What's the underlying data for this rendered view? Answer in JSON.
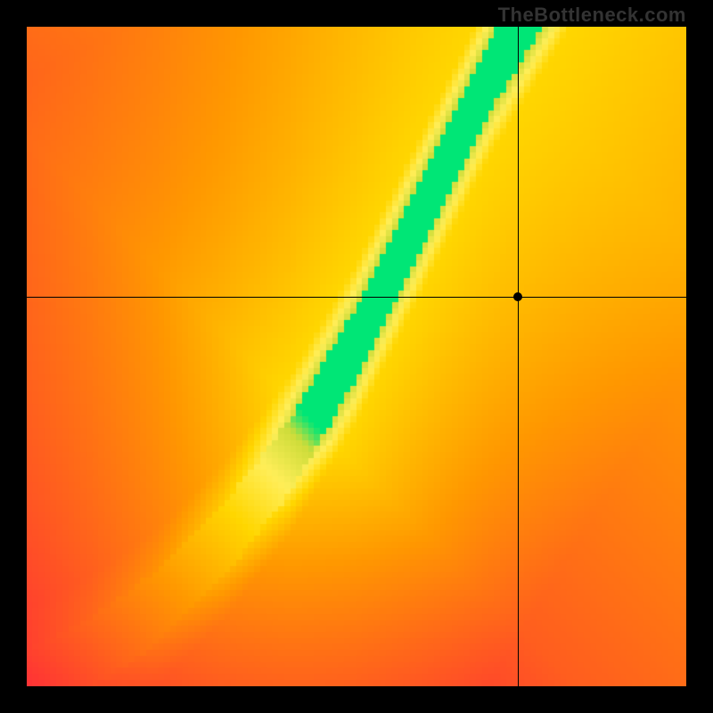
{
  "watermark": "TheBottleneck.com",
  "chart_data": {
    "type": "heatmap",
    "title": "",
    "xlabel": "",
    "ylabel": "",
    "xlim": [
      0,
      1
    ],
    "ylim": [
      0,
      1
    ],
    "crosshair": {
      "x": 0.745,
      "y": 0.59
    },
    "marker": {
      "x": 0.745,
      "y": 0.59
    },
    "ridge": [
      {
        "x": 0.0,
        "y": 0.0
      },
      {
        "x": 0.1,
        "y": 0.05
      },
      {
        "x": 0.2,
        "y": 0.12
      },
      {
        "x": 0.3,
        "y": 0.22
      },
      {
        "x": 0.4,
        "y": 0.35
      },
      {
        "x": 0.5,
        "y": 0.52
      },
      {
        "x": 0.55,
        "y": 0.62
      },
      {
        "x": 0.6,
        "y": 0.72
      },
      {
        "x": 0.65,
        "y": 0.82
      },
      {
        "x": 0.7,
        "y": 0.92
      },
      {
        "x": 0.75,
        "y": 1.0
      }
    ],
    "color_stops": [
      {
        "t": 0.0,
        "color": "#ff1744"
      },
      {
        "t": 0.25,
        "color": "#ff5722"
      },
      {
        "t": 0.5,
        "color": "#ff9800"
      },
      {
        "t": 0.72,
        "color": "#ffd600"
      },
      {
        "t": 0.85,
        "color": "#ffee58"
      },
      {
        "t": 0.95,
        "color": "#cddc39"
      },
      {
        "t": 1.0,
        "color": "#00e676"
      }
    ],
    "green_halfwidth": 0.055,
    "yellow_halfwidth": 0.12,
    "bg_falloff": 0.8,
    "pixelation": 110
  }
}
